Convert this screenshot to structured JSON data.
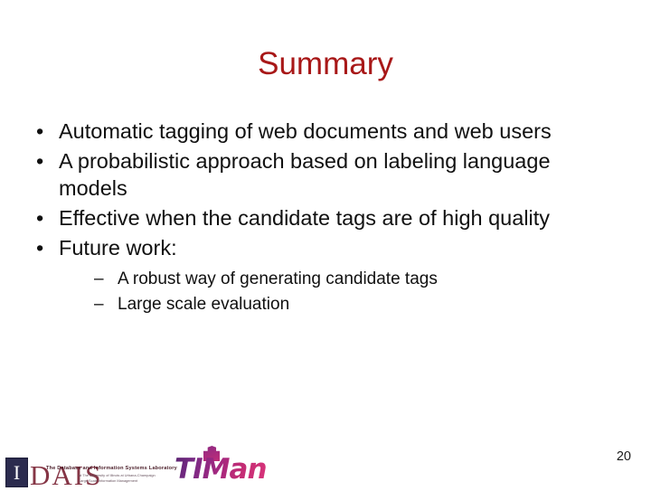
{
  "slide": {
    "title": "Summary",
    "title_color": "#a81818",
    "background_color": "#ffffff",
    "page_number": "20"
  },
  "content": {
    "bullet_marker": "•",
    "sub_bullet_marker": "–",
    "bullets": [
      {
        "text": "Automatic tagging of web documents and web users"
      },
      {
        "text": "A probabilistic approach based on labeling language models"
      },
      {
        "text": "Effective when the candidate tags are of high quality"
      },
      {
        "text": "Future work:",
        "sub_bullets": [
          {
            "text": "A robust way of generating candidate tags"
          },
          {
            "text": "Large scale evaluation"
          }
        ]
      }
    ]
  },
  "footer": {
    "dais_logo": {
      "emblem_letter": "I",
      "wordmark": "DAIS",
      "tagline": "The Database and Information Systems Laboratory",
      "subline1": "at The University of Illinois at Urbana-Champaign",
      "subline2": "Large Scale Information Management",
      "emblem_color": "#2b2b4e",
      "wordmark_color": "#7b2436"
    },
    "timan_logo": {
      "text": "TIMan",
      "gradient_start": "#5a2470",
      "gradient_end": "#d9347a"
    }
  }
}
